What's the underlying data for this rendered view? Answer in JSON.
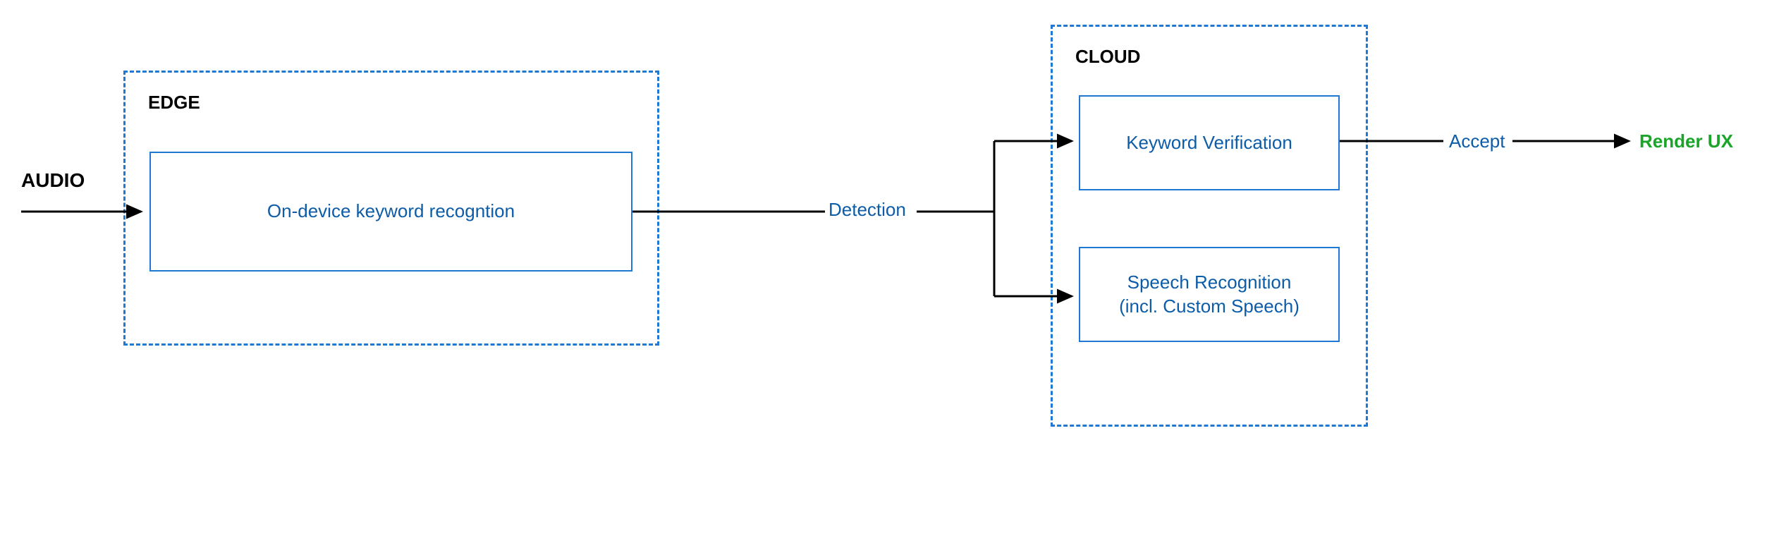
{
  "labels": {
    "audio": "AUDIO",
    "edge": "EDGE",
    "cloud": "CLOUD",
    "on_device": "On-device keyword recogntion",
    "detection": "Detection",
    "keyword_verification": "Keyword Verification",
    "speech_recognition": "Speech Recognition\n(incl. Custom Speech)",
    "accept": "Accept",
    "render_ux": "Render UX"
  },
  "colors": {
    "blue": "#1f78d1",
    "text_blue": "#0c5ca8",
    "green": "#1aa429",
    "black": "#000000"
  }
}
